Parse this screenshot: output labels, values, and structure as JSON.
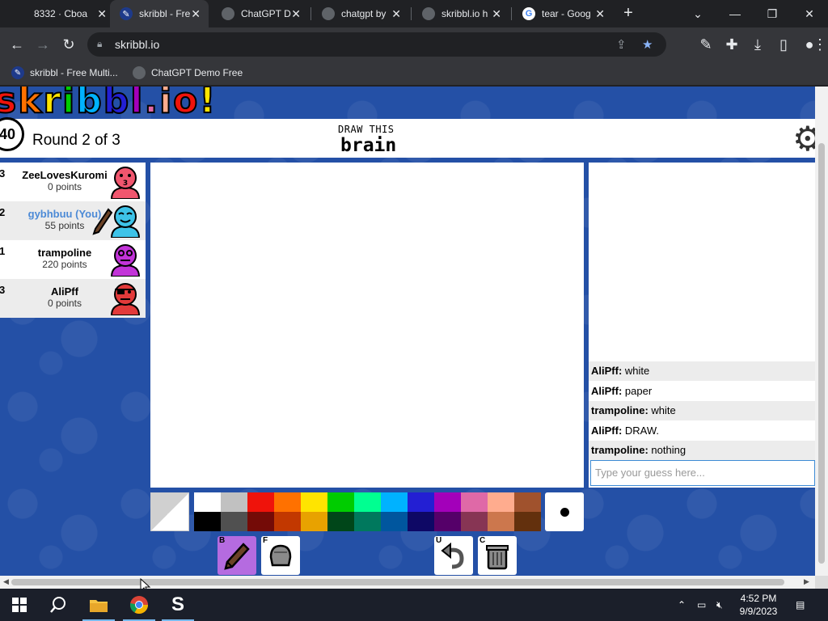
{
  "browser": {
    "tabs": [
      {
        "title": "8332 · Cboa",
        "icon": "chrome-tab-icon",
        "active": false
      },
      {
        "title": "skribbl - Fre",
        "icon": "skribbl-favicon",
        "active": true
      },
      {
        "title": "ChatGPT D",
        "icon": "globe-icon",
        "active": false
      },
      {
        "title": "chatgpt by",
        "icon": "globe-icon",
        "active": false
      },
      {
        "title": "skribbl.io h",
        "icon": "globe-icon",
        "active": false
      },
      {
        "title": "tear - Goog",
        "icon": "google-icon",
        "active": false
      }
    ],
    "new_tab": "+",
    "url": "skribbl.io",
    "bookmarks": [
      {
        "label": "skribbl - Free Multi...",
        "icon": "skribbl-favicon"
      },
      {
        "label": "ChatGPT Demo Free",
        "icon": "globe-icon"
      }
    ]
  },
  "game": {
    "logo": "skribbl.io",
    "timer": "40",
    "round": "Round 2 of 3",
    "draw_label": "DRAW THIS",
    "word": "brain",
    "players": [
      {
        "rank": "3",
        "name": "ZeeLovesKuromi",
        "points": "0 points",
        "is_me": false,
        "avatar_color": "#f0566e"
      },
      {
        "rank": "2",
        "name": "gybhbuu (You)",
        "points": "55 points",
        "is_me": true,
        "drawing": true,
        "avatar_color": "#3dc3e8"
      },
      {
        "rank": "1",
        "name": "trampoline",
        "points": "220 points",
        "is_me": false,
        "avatar_color": "#c233d8"
      },
      {
        "rank": "3",
        "name": "AliPff",
        "points": "0 points",
        "is_me": false,
        "avatar_color": "#e23a3a"
      }
    ],
    "chat": [
      {
        "who": "AliPff:",
        "text": "white"
      },
      {
        "who": "AliPff:",
        "text": "paper"
      },
      {
        "who": "trampoline:",
        "text": "white"
      },
      {
        "who": "AliPff:",
        "text": "DRAW."
      },
      {
        "who": "trampoline:",
        "text": "nothing"
      }
    ],
    "chat_placeholder": "Type your guess here...",
    "palette_top": [
      "#ffffff",
      "#c1c1c1",
      "#ef130b",
      "#ff7100",
      "#ffe400",
      "#00cc00",
      "#00ff91",
      "#00b2ff",
      "#231fd3",
      "#a300ba",
      "#df69a7",
      "#ffac8e",
      "#a0522d"
    ],
    "palette_bottom": [
      "#000000",
      "#505050",
      "#740b07",
      "#c23800",
      "#e8a200",
      "#004619",
      "#00785d",
      "#00569e",
      "#0e0865",
      "#550069",
      "#873554",
      "#cc774d",
      "#63300d"
    ],
    "tools": [
      {
        "key": "B",
        "name": "brush",
        "selected": true
      },
      {
        "key": "F",
        "name": "fill",
        "selected": false
      },
      {
        "key": "U",
        "name": "undo",
        "selected": false
      },
      {
        "key": "C",
        "name": "clear",
        "selected": false
      }
    ]
  },
  "taskbar": {
    "time": "4:52 PM",
    "date": "9/9/2023"
  }
}
